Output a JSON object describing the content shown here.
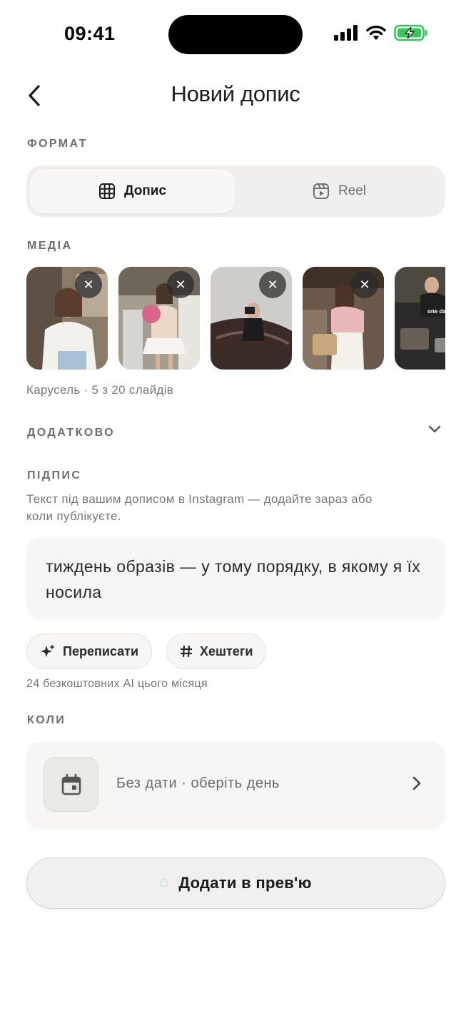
{
  "status_bar": {
    "time": "09:41"
  },
  "header": {
    "title": "Новий допис"
  },
  "format": {
    "label": "ФОРМАТ",
    "options": [
      {
        "label": "Допис",
        "icon": "grid-icon",
        "selected": true
      },
      {
        "label": "Reel",
        "icon": "reel-icon",
        "selected": false
      }
    ]
  },
  "media": {
    "label": "МЕДІА",
    "summary": "Карусель · 5 з 20 слайдів",
    "thumbnails": [
      {
        "remove_glyph": "✕"
      },
      {
        "remove_glyph": "✕"
      },
      {
        "remove_glyph": "✕"
      },
      {
        "remove_glyph": "✕"
      },
      {
        "overlay_text": "one day"
      }
    ]
  },
  "extra": {
    "label": "ДОДАТКОВО"
  },
  "caption": {
    "label": "ПІДПИС",
    "hint_line1": "Текст під вашим дописом в Instagram — додайте зараз або",
    "hint_line2": "коли публікуєте.",
    "value": "тиждень образів — у тому порядку, в якому я їх носила"
  },
  "ai": {
    "rewrite_label": "Переписати",
    "hashtags_label": "Хештеги",
    "quota_text": "24 безкоштовних AI цього місяця"
  },
  "when": {
    "label": "КОЛИ",
    "value": "Без дати · оберіть день"
  },
  "cta": {
    "label": "Додати в прев'ю"
  },
  "colors": {
    "background": "#ffffff",
    "surface": "#f7f6f4",
    "muted_text": "#777777"
  }
}
